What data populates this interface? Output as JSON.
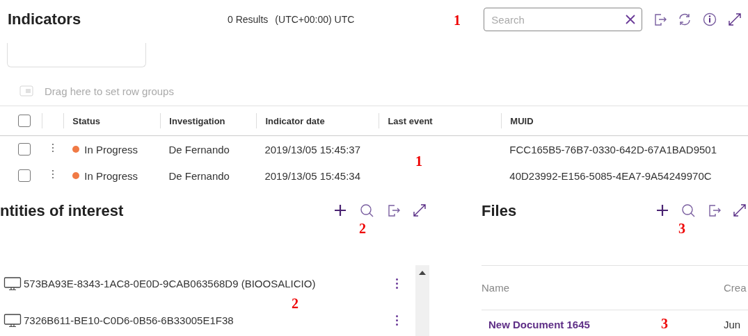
{
  "indicators": {
    "title": "Indicators",
    "results": "0 Results",
    "timezone": "(UTC+00:00) UTC",
    "marker": "1",
    "search": {
      "placeholder": "Search"
    },
    "group_bar": {
      "text": "Drag here to set row groups"
    },
    "table": {
      "select_all_checked": false,
      "columns": [
        "Status",
        "Investigation",
        "Indicator date",
        "Last event",
        "MUID"
      ],
      "rows": [
        {
          "checked": false,
          "status": "In Progress",
          "color": "#f07a45",
          "investigation": "De Fernando",
          "indicator_date": "2019/13/05 15:45:37",
          "last_event": "",
          "muid": "FCC165B5-76B7-0330-642D-67A1BAD9501"
        },
        {
          "checked": false,
          "status": "In Progress",
          "color": "#f07a45",
          "investigation": "De Fernando",
          "indicator_date": "2019/13/05 15:45:34",
          "last_event": "",
          "muid": "40D23992-E156-5085-4EA7-9A54249970C"
        }
      ],
      "marker": "1"
    }
  },
  "entities": {
    "title": "ntities of interest",
    "marker": "2",
    "items": [
      {
        "label": "573BA93E-8343-1AC8-0E0D-9CAB063568D9 (BIOOSALICIO)"
      },
      {
        "label": "7326B611-BE10-C0D6-0B56-6B33005E1F38"
      }
    ],
    "list_marker": "2"
  },
  "files": {
    "title": "Files",
    "marker": "3",
    "columns": [
      "Name",
      "Crea"
    ],
    "rows": [
      {
        "name": "New Document 1645",
        "created": "Jun"
      }
    ],
    "row_marker": "3"
  }
}
